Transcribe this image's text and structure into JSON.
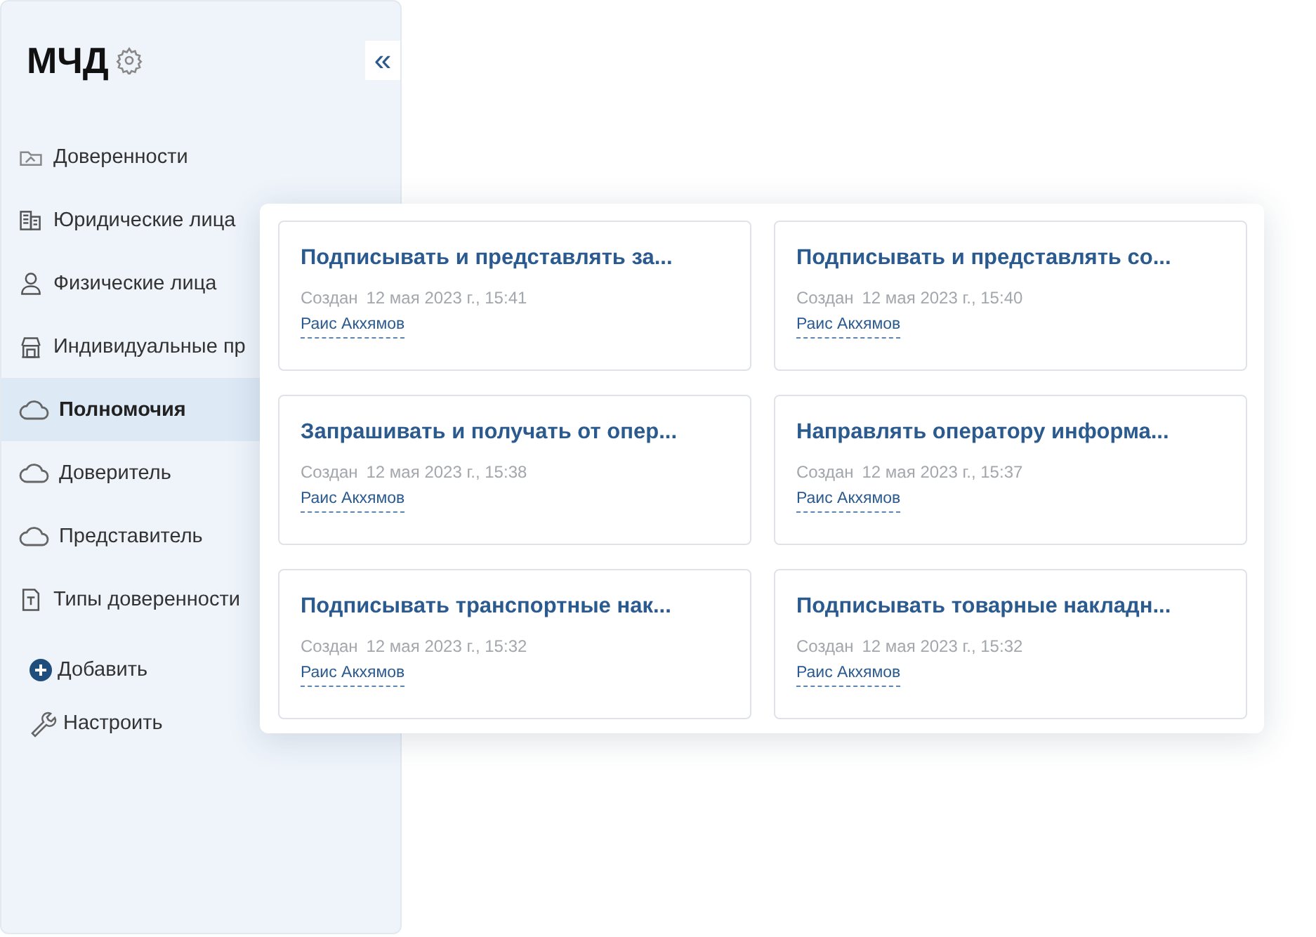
{
  "sidebar": {
    "title": "МЧД",
    "collapse_label": "«",
    "items": [
      {
        "label": "Доверенности",
        "kind": "folder",
        "selected": false
      },
      {
        "label": "Юридические лица",
        "kind": "building",
        "selected": false
      },
      {
        "label": "Физические лица",
        "kind": "person",
        "selected": false
      },
      {
        "label": "Индивидуальные пр",
        "kind": "shop",
        "selected": false
      },
      {
        "label": "Полномочия",
        "kind": "cloud",
        "selected": true
      },
      {
        "label": "Доверитель",
        "kind": "cloud",
        "selected": false
      },
      {
        "label": "Представитель",
        "kind": "cloud",
        "selected": false
      },
      {
        "label": "Типы доверенности",
        "kind": "document",
        "selected": false
      }
    ],
    "actions": [
      {
        "label": "Добавить",
        "kind": "add"
      },
      {
        "label": "Настроить",
        "kind": "configure"
      }
    ]
  },
  "cards": [
    {
      "title": "Подписывать и представлять за...",
      "created_label": "Создан",
      "date": "12 мая 2023 г., 15:41",
      "author": "Раис Акхямов"
    },
    {
      "title": "Подписывать и представлять со...",
      "created_label": "Создан",
      "date": "12 мая 2023 г., 15:40",
      "author": "Раис Акхямов"
    },
    {
      "title": "Запрашивать и получать от опер...",
      "created_label": "Создан",
      "date": "12 мая 2023 г., 15:38",
      "author": "Раис Акхямов"
    },
    {
      "title": "Направлять оператору информа...",
      "created_label": "Создан",
      "date": "12 мая 2023 г., 15:37",
      "author": "Раис Акхямов"
    },
    {
      "title": "Подписывать транспортные нак...",
      "created_label": "Создан",
      "date": "12 мая 2023 г., 15:32",
      "author": "Раис Акхямов"
    },
    {
      "title": "Подписывать товарные накладн...",
      "created_label": "Создан",
      "date": "12 мая 2023 г., 15:32",
      "author": "Раис Акхямов"
    }
  ]
}
